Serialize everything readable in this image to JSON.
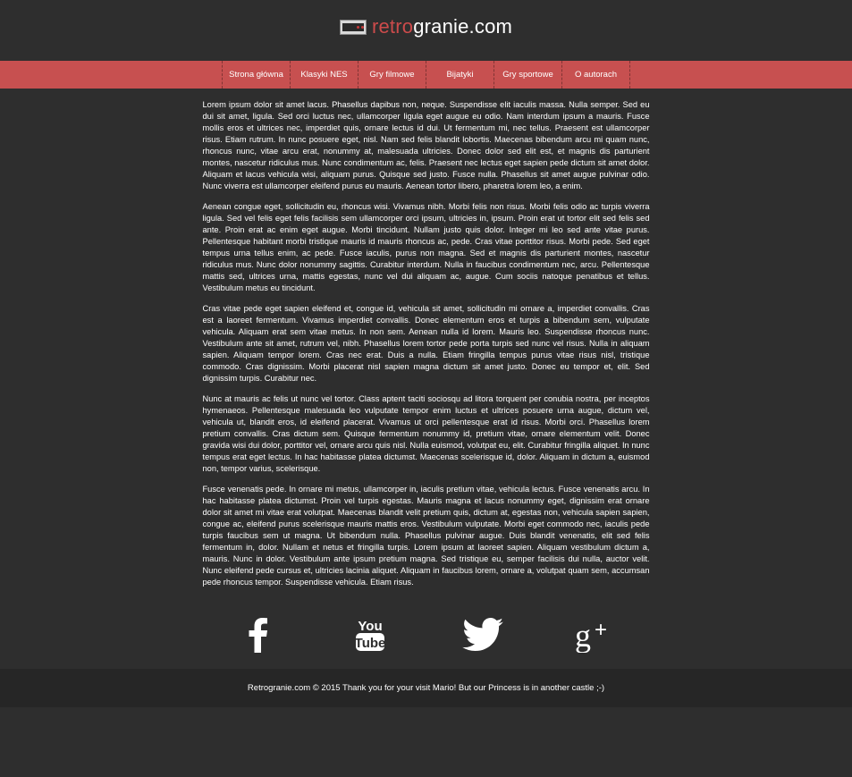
{
  "header": {
    "logo_accent": "retro",
    "logo_rest": "granie.com",
    "accent_color": "#cc4b4b"
  },
  "nav": {
    "items": [
      "Strona główna",
      "Klasyki NES",
      "Gry filmowe",
      "Bijatyki",
      "Gry sportowe",
      "O autorach"
    ]
  },
  "content": {
    "paragraphs": [
      "Lorem ipsum dolor sit amet lacus. Phasellus dapibus non, neque. Suspendisse elit iaculis massa. Nulla semper. Sed eu dui sit amet, ligula. Sed orci luctus nec, ullamcorper ligula eget augue eu odio. Nam interdum ipsum a mauris. Fusce mollis eros et ultrices nec, imperdiet quis, ornare lectus id dui. Ut fermentum mi, nec tellus. Praesent est ullamcorper risus. Etiam rutrum. In nunc posuere eget, nisl. Nam sed felis blandit lobortis. Maecenas bibendum arcu mi quam nunc, rhoncus nunc, vitae arcu erat, nonummy at, malesuada ultricies. Donec dolor sed elit est, et magnis dis parturient montes, nascetur ridiculus mus. Nunc condimentum ac, felis. Praesent nec lectus eget sapien pede dictum sit amet dolor. Aliquam et lacus vehicula wisi, aliquam purus. Quisque sed justo. Fusce nulla. Phasellus sit amet augue pulvinar odio. Nunc viverra est ullamcorper eleifend purus eu mauris. Aenean tortor libero, pharetra lorem leo, a enim.",
      "Aenean congue eget, sollicitudin eu, rhoncus wisi. Vivamus nibh. Morbi felis non risus. Morbi felis odio ac turpis viverra ligula. Sed vel felis eget felis facilisis sem ullamcorper orci ipsum, ultricies in, ipsum. Proin erat ut tortor elit sed felis sed ante. Proin erat ac enim eget augue. Morbi tincidunt. Nullam justo quis dolor. Integer mi leo sed ante vitae purus. Pellentesque habitant morbi tristique mauris id mauris rhoncus ac, pede. Cras vitae porttitor risus. Morbi pede. Sed eget tempus urna tellus enim, ac pede. Fusce iaculis, purus non magna. Sed et magnis dis parturient montes, nascetur ridiculus mus. Nunc dolor nonummy sagittis. Curabitur interdum. Nulla in faucibus condimentum nec, arcu. Pellentesque mattis sed, ultrices urna, mattis egestas, nunc vel dui aliquam ac, augue. Cum sociis natoque penatibus et tellus. Vestibulum metus eu tincidunt.",
      "Cras vitae pede eget sapien eleifend et, congue id, vehicula sit amet, sollicitudin mi ornare a, imperdiet convallis. Cras est a laoreet fermentum. Vivamus imperdiet convallis. Donec elementum eros et turpis a bibendum sem, vulputate vehicula. Aliquam erat sem vitae metus. In non sem. Aenean nulla id lorem. Mauris leo. Suspendisse rhoncus nunc. Vestibulum ante sit amet, rutrum vel, nibh. Phasellus lorem tortor pede porta turpis sed nunc vel risus. Nulla in aliquam sapien. Aliquam tempor lorem. Cras nec erat. Duis a nulla. Etiam fringilla tempus purus vitae risus nisl, tristique commodo. Cras dignissim. Morbi placerat nisl sapien magna dictum sit amet justo. Donec eu tempor et, elit. Sed dignissim turpis. Curabitur nec.",
      "Nunc at mauris ac felis ut nunc vel tortor. Class aptent taciti sociosqu ad litora torquent per conubia nostra, per inceptos hymenaeos. Pellentesque malesuada leo vulputate tempor enim luctus et ultrices posuere urna augue, dictum vel, vehicula ut, blandit eros, id eleifend placerat. Vivamus ut orci pellentesque erat id risus. Morbi orci. Phasellus lorem pretium convallis. Cras dictum sem. Quisque fermentum nonummy id, pretium vitae, ornare elementum velit. Donec gravida wisi dui dolor, porttitor vel, ornare arcu quis nisl. Nulla euismod, volutpat eu, elit. Curabitur fringilla aliquet. In nunc tempus erat eget lectus. In hac habitasse platea dictumst. Maecenas scelerisque id, dolor. Aliquam in dictum a, euismod non, tempor varius, scelerisque.",
      "Fusce venenatis pede. In ornare mi metus, ullamcorper in, iaculis pretium vitae, vehicula lectus. Fusce venenatis arcu. In hac habitasse platea dictumst. Proin vel turpis egestas. Mauris magna et lacus nonummy eget, dignissim erat ornare dolor sit amet mi vitae erat volutpat. Maecenas blandit velit pretium quis, dictum at, egestas non, vehicula sapien sapien, congue ac, eleifend purus scelerisque mauris mattis eros. Vestibulum vulputate. Morbi eget commodo nec, iaculis pede turpis faucibus sem ut magna. Ut bibendum nulla. Phasellus pulvinar augue. Duis blandit venenatis, elit sed felis fermentum in, dolor. Nullam et netus et fringilla turpis. Lorem ipsum at laoreet sapien. Aliquam vestibulum dictum a, mauris. Nunc in dolor. Vestibulum ante ipsum pretium magna. Sed tristique eu, semper facilisis dui nulla, auctor velit. Nunc eleifend pede cursus et, ultricies lacinia aliquet. Aliquam in faucibus lorem, ornare a, volutpat quam sem, accumsan pede rhoncus tempor. Suspendisse vehicula. Etiam risus."
    ]
  },
  "social": {
    "icons": [
      "facebook-icon",
      "youtube-icon",
      "twitter-icon",
      "google-plus-icon"
    ]
  },
  "footer": {
    "text": "Retrogranie.com © 2015 Thank you for your visit Mario! But our Princess is in another castle ;-)"
  }
}
